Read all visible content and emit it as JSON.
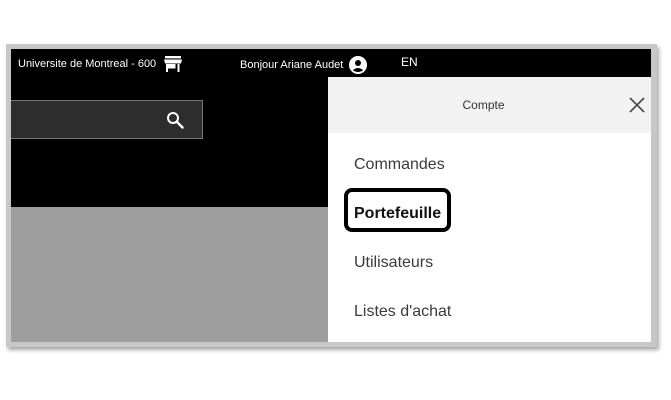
{
  "topbar": {
    "store_label": "Universite de Montreal - 600",
    "store_icon": "store-icon",
    "greeting": "Bonjour Ariane Audet",
    "account_icon": "account-circle-icon",
    "language": "EN"
  },
  "search": {
    "icon": "search-icon"
  },
  "drawer": {
    "title": "Compte",
    "close_icon": "close-icon",
    "items": [
      {
        "label": "Commandes"
      },
      {
        "label": "Portefeuille",
        "bold": true,
        "highlighted": true
      },
      {
        "label": "Utilisateurs"
      },
      {
        "label": "Listes d'achat"
      }
    ]
  }
}
